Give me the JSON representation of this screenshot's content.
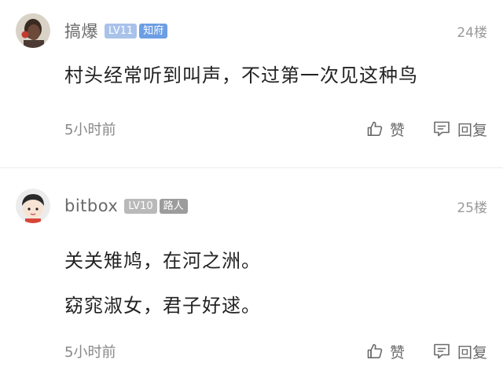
{
  "comments": [
    {
      "username": "搞爆",
      "level": "LV11",
      "role": "知府",
      "floor": "24楼",
      "lines": [
        "村头经常听到叫声，不过第一次见这种鸟"
      ],
      "time": "5小时前",
      "like_label": "赞",
      "reply_label": "回复"
    },
    {
      "username": "bitbox",
      "level": "LV10",
      "role": "路人",
      "floor": "25楼",
      "lines": [
        "关关雉鸠，在河之洲。",
        "窈窕淑女，君子好逑。"
      ],
      "time": "5小时前",
      "like_label": "赞",
      "reply_label": "回复"
    }
  ],
  "colors": {
    "text_primary": "#222222",
    "text_secondary": "#888888",
    "badge_blue": "#6c9ee3",
    "badge_gray": "#9c9c9c"
  },
  "icons": [
    "thumbs-up-icon",
    "reply-bubble-icon"
  ]
}
